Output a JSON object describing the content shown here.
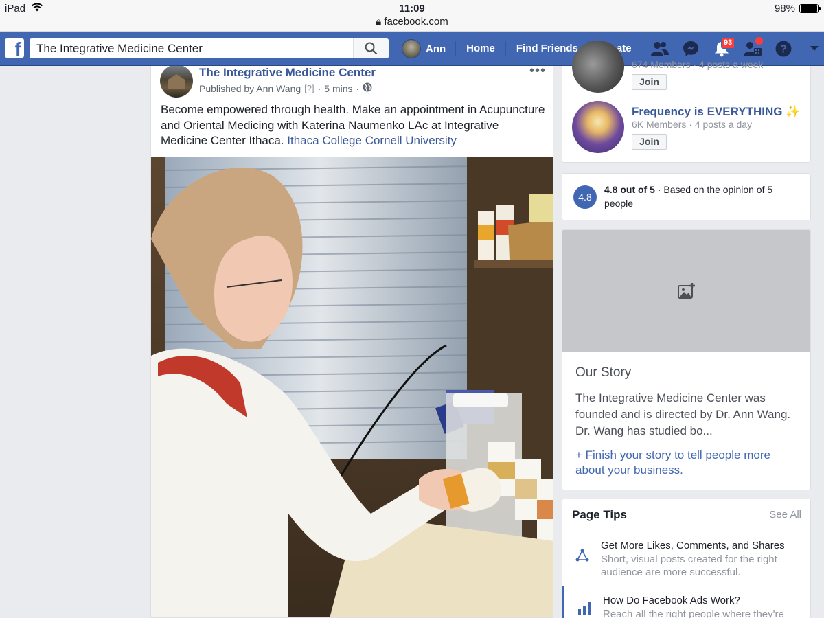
{
  "status_bar": {
    "device": "iPad",
    "time": "11:09",
    "url": "facebook.com",
    "battery": "98%",
    "battery_level": 0.98
  },
  "nav": {
    "search_value": "The Integrative Medicine Center",
    "user_name": "Ann",
    "links": [
      "Home",
      "Find Friends",
      "Create"
    ],
    "notification_count": "93",
    "brand_color": "#4267b2"
  },
  "post": {
    "page_name": "The Integrative Medicine Center",
    "published_by": "Published by Ann Wang",
    "help_marker": "[?]",
    "time": "5 mins",
    "more": "•••",
    "text": "Become empowered through health. Make an appointment in Acupuncture and Oriental Medicing with Katerina Naumenko LAc at Integrative Medicine Center Ithaca.",
    "tags": [
      "Ithaca College",
      "Cornell University"
    ]
  },
  "groups": [
    {
      "name": "",
      "meta_members": "674 Members",
      "meta_posts": "4 posts a week",
      "join": "Join"
    },
    {
      "name": "Frequency is EVERYTHING ✨",
      "meta_members": "6K Members",
      "meta_posts": "4 posts a day",
      "join": "Join"
    }
  ],
  "rating": {
    "score": "4.8",
    "summary": "4.8 out of 5",
    "detail": "Based on the opinion of 5 people"
  },
  "story": {
    "heading": "Our Story",
    "body": "The Integrative Medicine Center was founded and is directed by Dr. Ann Wang. Dr. Wang has studied bo...",
    "link": "+ Finish your story to tell people more about your business."
  },
  "page_tips": {
    "heading": "Page Tips",
    "see_all": "See All",
    "items": [
      {
        "title": "Get More Likes, Comments, and Shares",
        "desc": "Short, visual posts created for the right audience are more successful.",
        "icon": "share-triangle-icon"
      },
      {
        "title": "How Do Facebook Ads Work?",
        "desc": "Reach all the right people where they're",
        "icon": "bar-chart-icon"
      }
    ]
  }
}
